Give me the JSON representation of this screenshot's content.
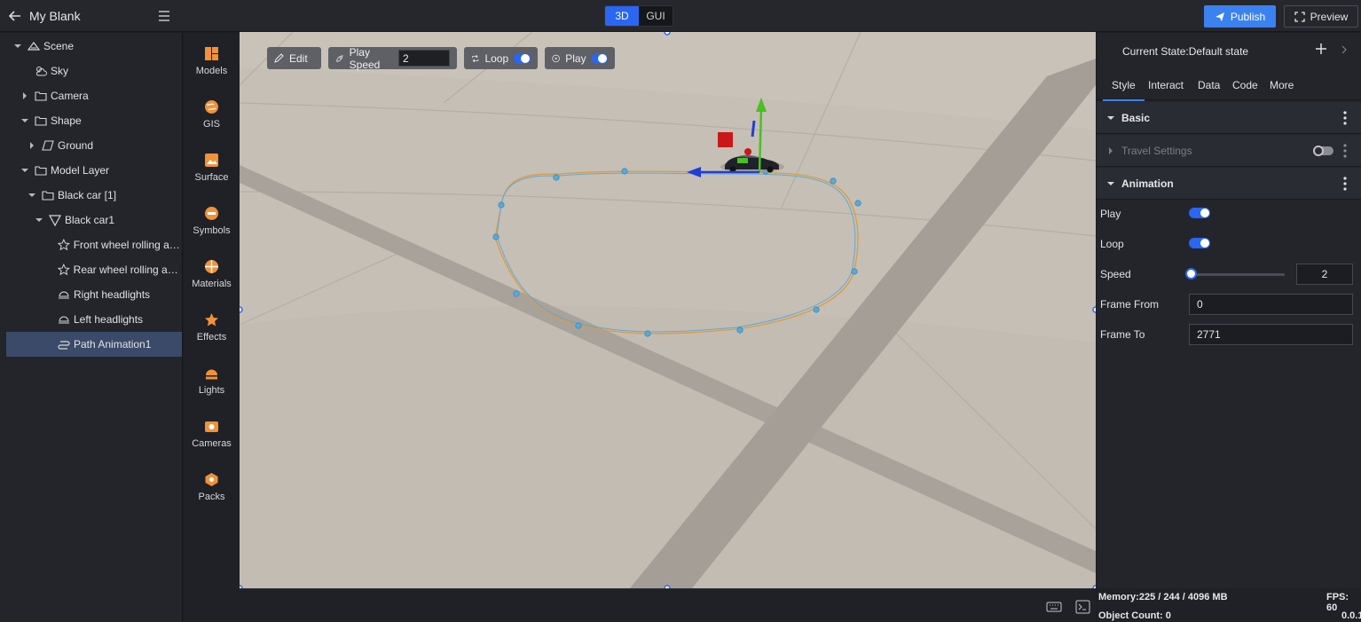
{
  "app": {
    "title": "My Blank"
  },
  "mode_switch": {
    "options": [
      "3D",
      "GUI"
    ],
    "active": "3D"
  },
  "actions": {
    "publish": "Publish",
    "preview": "Preview"
  },
  "tree": [
    {
      "label": "Scene",
      "icon": "scene-icon",
      "expanded": true
    },
    {
      "label": "Sky",
      "icon": "sky-icon"
    },
    {
      "label": "Camera",
      "icon": "folder-icon",
      "expanded": false
    },
    {
      "label": "Shape",
      "icon": "folder-icon",
      "expanded": true
    },
    {
      "label": "Ground",
      "icon": "plane-icon",
      "expanded": false
    },
    {
      "label": "Model Layer",
      "icon": "folder-icon",
      "expanded": true
    },
    {
      "label": "Black car [1]",
      "icon": "folder-icon",
      "expanded": true
    },
    {
      "label": "Black car1",
      "icon": "model-icon",
      "expanded": true
    },
    {
      "label": "Front wheel rolling an...",
      "icon": "star-icon"
    },
    {
      "label": "Rear wheel rolling ani...",
      "icon": "star-icon"
    },
    {
      "label": "Right headlights",
      "icon": "headlight-icon"
    },
    {
      "label": "Left headlights",
      "icon": "headlight-icon"
    },
    {
      "label": "Path Animation1",
      "icon": "path-icon",
      "selected": true
    }
  ],
  "assets": [
    "Models",
    "GIS",
    "Surface",
    "Symbols",
    "Materials",
    "Effects",
    "Lights",
    "Cameras",
    "Packs"
  ],
  "viewport_toolbar": {
    "edit": "Edit",
    "play_speed_label": "Play Speed",
    "play_speed_value": "2",
    "loop": "Loop",
    "play": "Play"
  },
  "right_panel": {
    "state": "Current State:Default state",
    "tabs": [
      "Style",
      "Interact",
      "Data",
      "Code",
      "More"
    ],
    "active_tab": "Style",
    "sections": {
      "basic": "Basic",
      "travel": "Travel Settings",
      "animation": "Animation"
    },
    "props": {
      "play_label": "Play",
      "play_on": true,
      "loop_label": "Loop",
      "loop_on": true,
      "speed_label": "Speed",
      "speed_value": "2",
      "frame_from_label": "Frame From",
      "frame_from": "0",
      "frame_to_label": "Frame To",
      "frame_to": "2771"
    }
  },
  "status": {
    "memory": "Memory:225 / 244 / 4096 MB",
    "fps": "FPS: 60",
    "object_count": "Object Count: 0",
    "version": "0.0.1"
  },
  "colors": {
    "accent": "#2a66f1",
    "publish": "#3b82f0",
    "asset_icon": "#f0923a"
  }
}
